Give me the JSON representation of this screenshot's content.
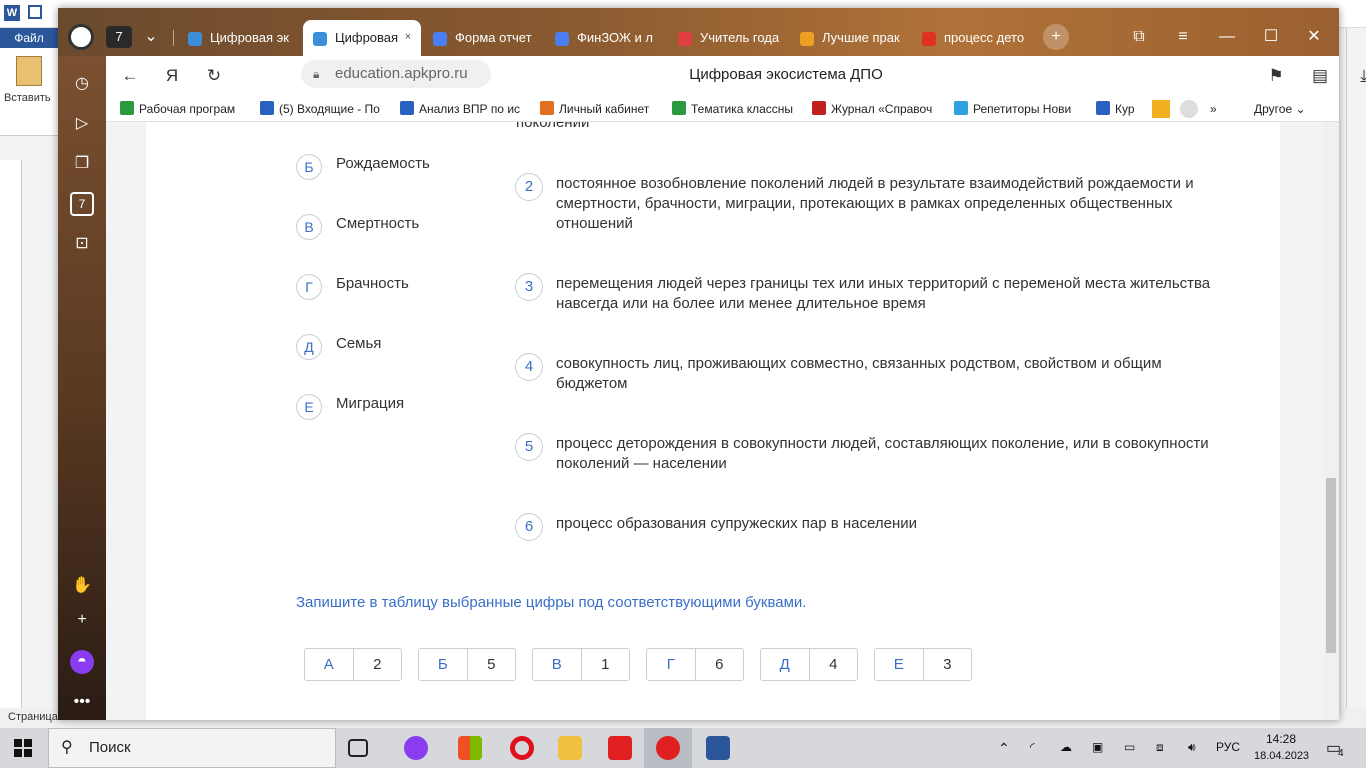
{
  "word": {
    "file_label": "Файл",
    "paste_label": "Вставить",
    "status_page": "Страница"
  },
  "browser": {
    "tab_counter": "7",
    "tabs": [
      {
        "label": "Цифровая эк",
        "color": "#3a8fd8"
      },
      {
        "label": "Цифровая",
        "color": "#3a8fd8"
      },
      {
        "label": "Форма отчет",
        "color": "#4a7ef0"
      },
      {
        "label": "ФинЗОЖ и л",
        "color": "#4a7ef0"
      },
      {
        "label": "Учитель года",
        "color": "#e04040"
      },
      {
        "label": "Лучшие прак",
        "color": "#f0a020"
      },
      {
        "label": "процесс дето",
        "color": "#e03020"
      }
    ],
    "address": "education.apkpro.ru",
    "page_title": "Цифровая экосистема ДПО",
    "bookmarks": [
      {
        "label": "Рабочая програм",
        "color": "#2a9a40"
      },
      {
        "label": "(5) Входящие - По",
        "color": "#2a60c0"
      },
      {
        "label": "Анализ ВПР по ис",
        "color": "#2a60c0"
      },
      {
        "label": "Личный кабинет",
        "color": "#e07020"
      },
      {
        "label": "Тематика классны",
        "color": "#2a9a40"
      },
      {
        "label": "Журнал «Справоч",
        "color": "#c02020"
      },
      {
        "label": "Репетиторы Нови",
        "color": "#30a0e0"
      },
      {
        "label": "Кур",
        "color": "#2a60c0"
      }
    ],
    "more_bookmarks": "Другое"
  },
  "quiz": {
    "options": [
      {
        "letter": "Б",
        "text": "Рождаемость"
      },
      {
        "letter": "В",
        "text": "Смертность"
      },
      {
        "letter": "Г",
        "text": "Брачность"
      },
      {
        "letter": "Д",
        "text": "Семья"
      },
      {
        "letter": "Е",
        "text": "Миграция"
      }
    ],
    "partial_top_text": "поколении",
    "definitions": [
      {
        "num": "2",
        "line1": "постоянное возобновление поколений людей в результате взаимодействий рождаемости и",
        "line2": "смертности, брачности, миграции, протекающих в рамках определенных общественных",
        "line3": "отношений"
      },
      {
        "num": "3",
        "line1": "перемещения людей через границы тех или иных территорий с переменой места жительства",
        "line2": "навсегда или на более или менее длительное время",
        "line3": ""
      },
      {
        "num": "4",
        "line1": "совокупность лиц, проживающих совместно, связанных родством, свойством и общим",
        "line2": "бюджетом",
        "line3": ""
      },
      {
        "num": "5",
        "line1": "процесс деторождения  в совокупности людей, составляющих поколение, или в совокупности",
        "line2": "поколений — населении",
        "line3": ""
      },
      {
        "num": "6",
        "line1": "процесс образования супружеских пар в населении",
        "line2": "",
        "line3": ""
      }
    ],
    "instruction": "Запишите в таблицу выбранные цифры под соответствующими буквами.",
    "answers": [
      {
        "letter": "А",
        "value": "2"
      },
      {
        "letter": "Б",
        "value": "5"
      },
      {
        "letter": "В",
        "value": "1"
      },
      {
        "letter": "Г",
        "value": "6"
      },
      {
        "letter": "Д",
        "value": "4"
      },
      {
        "letter": "Е",
        "value": "3"
      }
    ]
  },
  "taskbar": {
    "search_placeholder": "Поиск",
    "lang": "РУС",
    "time": "14:28",
    "date": "18.04.2023",
    "notif_count": "4"
  }
}
